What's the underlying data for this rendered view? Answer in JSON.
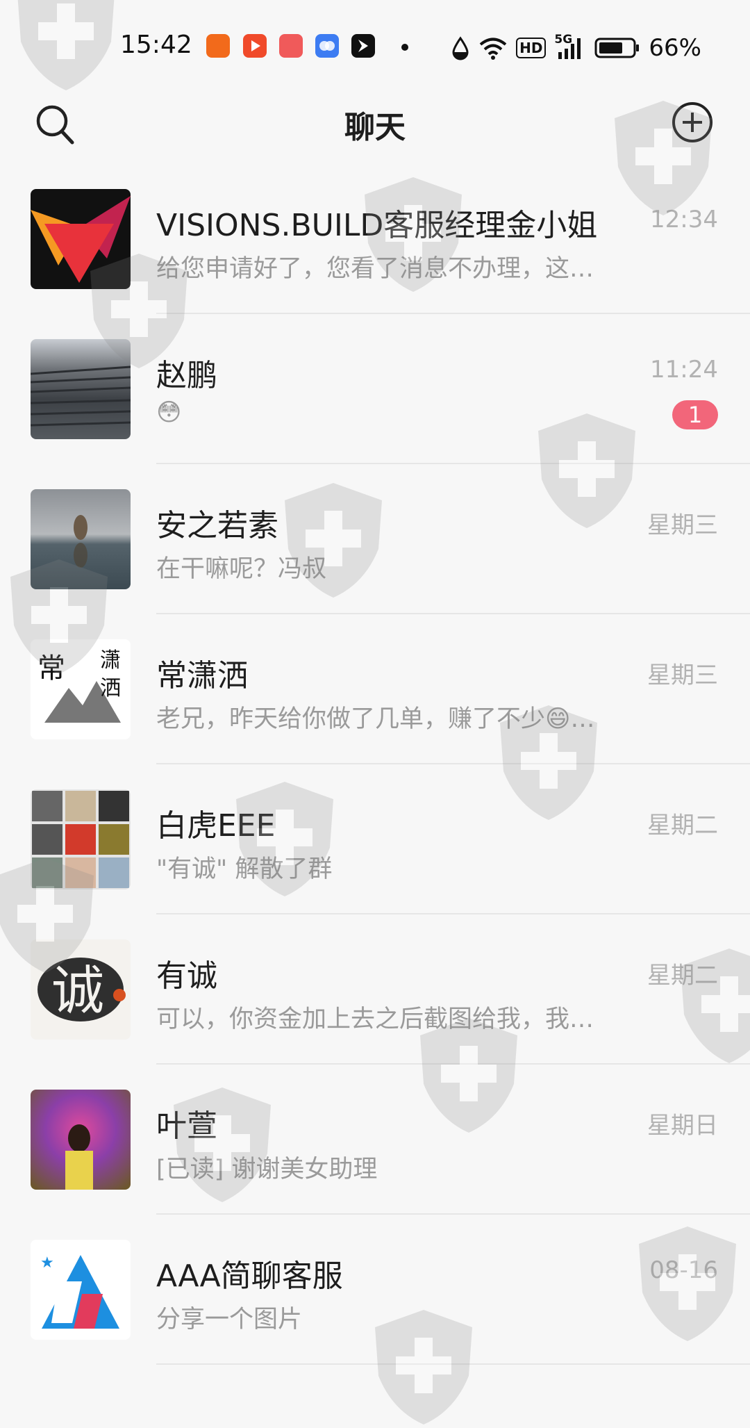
{
  "status_bar": {
    "time": "15:42",
    "hd": "HD",
    "network": "5G",
    "battery_pct": "66%"
  },
  "header": {
    "title": "聊天",
    "search_icon": "search-icon",
    "add_icon": "plus-circle-icon"
  },
  "chats": [
    {
      "name": "VISIONS.BUILD客服经理金小姐",
      "time": "12:34",
      "preview": "给您申请好了，您看了消息不办理，这…",
      "badge": ""
    },
    {
      "name": "赵鹏",
      "time": "11:24",
      "preview": "😳",
      "badge": "1"
    },
    {
      "name": "安之若素",
      "time": "星期三",
      "preview": "在干嘛呢？冯叔",
      "badge": ""
    },
    {
      "name": "常潇洒",
      "time": "星期三",
      "preview": "老兄，昨天给你做了几单，赚了不少😄…",
      "badge": ""
    },
    {
      "name": "白虎EEE",
      "time": "星期二",
      "preview": "\"有诚\" 解散了群",
      "badge": ""
    },
    {
      "name": "有诚",
      "time": "星期二",
      "preview": "可以，你资金加上去之后截图给我，我…",
      "badge": ""
    },
    {
      "name": "叶萱",
      "time": "星期日",
      "preview": "[已读] 谢谢美女助理",
      "badge": ""
    },
    {
      "name": "AAA简聊客服",
      "time": "08-16",
      "preview": "分享一个图片",
      "badge": ""
    }
  ],
  "avatar_text": {
    "chang": [
      "常",
      "潇",
      "洒"
    ],
    "youcheng": "诚"
  }
}
